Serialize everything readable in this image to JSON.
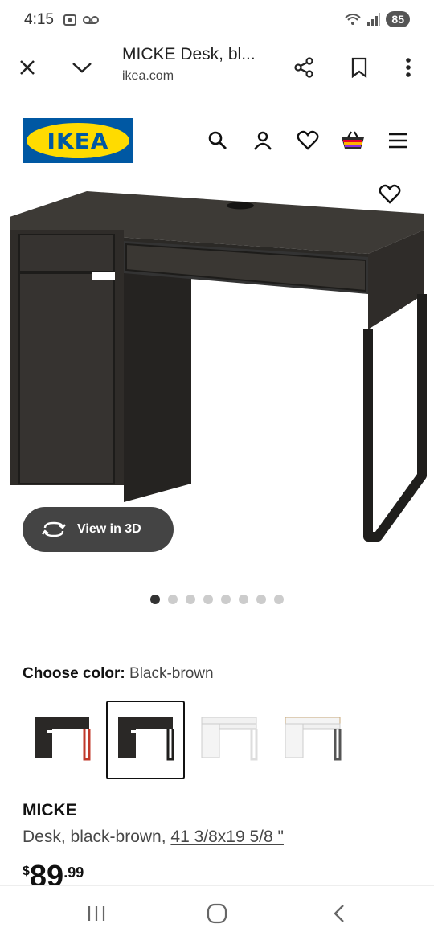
{
  "status": {
    "time": "4:15",
    "battery": "85"
  },
  "browser": {
    "title": "MICKE Desk, bl...",
    "domain": "ikea.com"
  },
  "brand": {
    "logo_text": "IKEA",
    "blue": "#0058a3",
    "yellow": "#ffdb00"
  },
  "header_icons": [
    "search-icon",
    "account-icon",
    "heart-icon",
    "cart-icon",
    "menu-icon"
  ],
  "gallery": {
    "view3d_label": "View in 3D",
    "dot_count": 8,
    "active_dot": 0
  },
  "color": {
    "label": "Choose color:",
    "value": "Black-brown"
  },
  "swatches": [
    "black-brown-red",
    "black-brown",
    "white",
    "white-oak"
  ],
  "product": {
    "name": "MICKE",
    "desc_prefix": "Desk, black-brown, ",
    "dimensions": "41 3/8x19 5/8 \"",
    "price_currency": "$",
    "price_integer": "89",
    "price_decimal": ".99"
  }
}
